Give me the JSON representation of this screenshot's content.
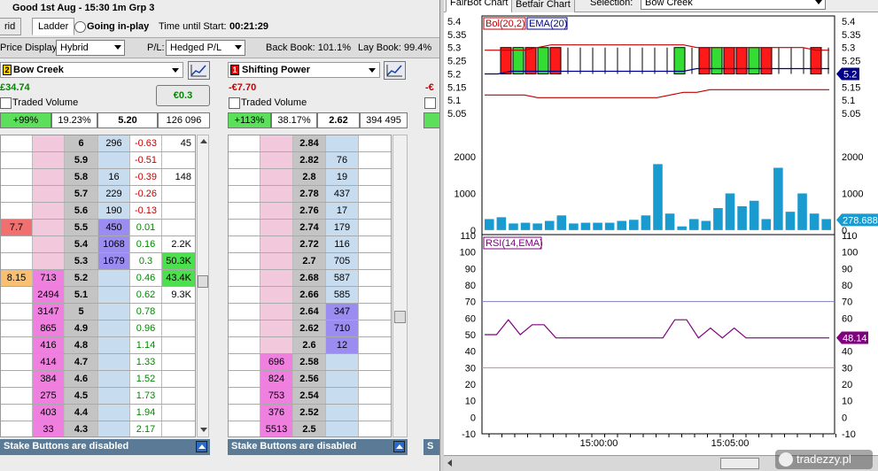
{
  "app": {
    "title": "Good 1st Aug - 15:30 1m Grp 3",
    "tab_hybrid_partial": "rid",
    "tab_ladder": "Ladder",
    "going_inplay": "Going in-play",
    "time_until_label": "Time until Start:",
    "time_until": "00:21:29"
  },
  "toolbar": {
    "price_display_label": "Price Display:",
    "price_display": "Hybrid",
    "pl_label": "P/L:",
    "pl_value": "Hedged P/L",
    "back_book": "Back Book: 101.1%",
    "lay_book": "Lay Book: 99.4%"
  },
  "runner1": {
    "num": "2",
    "name": "Bow Creek",
    "pnl": "£34.74",
    "hedge": "€0.3",
    "traded_volume": "Traded Volume",
    "stat_pct": "+99%",
    "stat_ratio": "19.23%",
    "stat_ltp": "5.20",
    "stat_vol": "126 096",
    "ladder": [
      [
        "",
        "",
        "6",
        "296",
        "-0.63",
        "45"
      ],
      [
        "",
        "",
        "5.9",
        "",
        "-0.51",
        ""
      ],
      [
        "",
        "",
        "5.8",
        "16",
        "-0.39",
        "148"
      ],
      [
        "",
        "",
        "5.7",
        "229",
        "-0.26",
        ""
      ],
      [
        "",
        "",
        "5.6",
        "190",
        "-0.13",
        ""
      ],
      [
        "7.7",
        "",
        "5.5",
        "450",
        "0.01",
        ""
      ],
      [
        "",
        "",
        "5.4",
        "1068",
        "0.16",
        "2.2K"
      ],
      [
        "",
        "",
        "5.3",
        "1679",
        "0.3",
        "50.3K"
      ],
      [
        "8.15",
        "713",
        "5.2",
        "",
        "0.46",
        "43.4K"
      ],
      [
        "",
        "2494",
        "5.1",
        "",
        "0.62",
        "9.3K"
      ],
      [
        "",
        "3147",
        "5",
        "",
        "0.78",
        ""
      ],
      [
        "",
        "865",
        "4.9",
        "",
        "0.96",
        ""
      ],
      [
        "",
        "416",
        "4.8",
        "",
        "1.14",
        ""
      ],
      [
        "",
        "414",
        "4.7",
        "",
        "1.33",
        ""
      ],
      [
        "",
        "384",
        "4.6",
        "",
        "1.52",
        ""
      ],
      [
        "",
        "275",
        "4.5",
        "",
        "1.73",
        ""
      ],
      [
        "",
        "403",
        "4.4",
        "",
        "1.94",
        ""
      ],
      [
        "",
        "33",
        "4.3",
        "",
        "2.17",
        ""
      ]
    ],
    "stake": "Stake Buttons are disabled"
  },
  "runner2": {
    "num": "1",
    "name": "Shifting Power",
    "pnl": "-€7.70",
    "traded_volume": "Traded Volume",
    "stat_pct": "+113%",
    "stat_ratio": "38.17%",
    "stat_ltp": "2.62",
    "stat_vol": "394 495",
    "ladder": [
      [
        "",
        "2.84",
        ""
      ],
      [
        "",
        "2.82",
        "76"
      ],
      [
        "",
        "2.8",
        "19"
      ],
      [
        "",
        "2.78",
        "437"
      ],
      [
        "",
        "2.76",
        "17"
      ],
      [
        "",
        "2.74",
        "179"
      ],
      [
        "",
        "2.72",
        "116"
      ],
      [
        "",
        "2.7",
        "705"
      ],
      [
        "",
        "2.68",
        "587"
      ],
      [
        "",
        "2.66",
        "585"
      ],
      [
        "",
        "2.64",
        "347"
      ],
      [
        "",
        "2.62",
        "710"
      ],
      [
        "",
        "2.6",
        "12"
      ],
      [
        "696",
        "2.58",
        ""
      ],
      [
        "824",
        "2.56",
        ""
      ],
      [
        "753",
        "2.54",
        ""
      ],
      [
        "376",
        "2.52",
        ""
      ],
      [
        "5513",
        "2.5",
        ""
      ]
    ],
    "stake": "Stake Buttons are disabled"
  },
  "runner3": {
    "pnl_partial": "-€",
    "stake_partial": "S"
  },
  "chart": {
    "tab_fairbot": "FairBot Chart",
    "tab_betfair": "Betfair Chart",
    "selection_label": "Selection:",
    "selection": "Bow Creek",
    "watermark": "tradezzy.pl",
    "legend_bol": "Bol(20,2)",
    "legend_ema": "EMA(20)",
    "legend_rsi": "RSI(14,EMA)",
    "colors": {
      "bull": "#33dd33",
      "bear": "#ff1a1a",
      "ema": "#00008b",
      "bol": "#c00000",
      "vol": "#1a9bd0",
      "rsi": "#800080"
    }
  },
  "chart_data": [
    {
      "type": "line",
      "title": "",
      "ylim": [
        5.0,
        5.42
      ],
      "y_ticks": [
        "5.4",
        "5.35",
        "5.3",
        "5.25",
        "5.2",
        "5.15",
        "5.1",
        "5.05"
      ],
      "last_label": "5.2",
      "series": [
        {
          "name": "Bol(20,2)",
          "values": [
            5.29,
            5.29,
            5.29,
            5.29,
            5.3,
            5.31,
            5.31,
            5.31,
            5.31,
            5.31,
            5.31,
            5.31,
            5.31,
            5.31,
            5.31,
            5.31,
            5.3,
            5.3,
            5.3,
            5.3,
            5.3,
            5.3,
            5.3,
            5.3,
            5.3,
            5.29,
            5.29
          ]
        },
        {
          "name": "EMA(20)",
          "values": [
            5.2,
            5.2,
            5.21,
            5.21,
            5.21,
            5.21,
            5.21,
            5.21,
            5.21,
            5.21,
            5.21,
            5.21,
            5.21,
            5.21,
            5.21,
            5.21,
            5.22,
            5.22,
            5.22,
            5.22,
            5.22,
            5.22,
            5.22,
            5.22,
            5.22,
            5.22,
            5.22
          ]
        },
        {
          "name": "lower band",
          "values": [
            5.12,
            5.12,
            5.12,
            5.12,
            5.11,
            5.11,
            5.11,
            5.11,
            5.11,
            5.11,
            5.11,
            5.11,
            5.11,
            5.11,
            5.12,
            5.13,
            5.13,
            5.14,
            5.14,
            5.14,
            5.14,
            5.14,
            5.14,
            5.14,
            5.14,
            5.14,
            5.14
          ]
        }
      ],
      "candles": [
        [
          "bear",
          5.3,
          5.2
        ],
        [
          "bull",
          5.2,
          5.3
        ],
        [
          "bear",
          5.3,
          5.2
        ],
        [
          "bull",
          5.2,
          5.3
        ],
        [
          "bear",
          5.3,
          5.2
        ],
        [
          "",
          5.2,
          5.2
        ],
        [
          "",
          5.2,
          5.2
        ],
        [
          "",
          5.2,
          5.2
        ],
        [
          "",
          5.2,
          5.2
        ],
        [
          "",
          5.2,
          5.2
        ],
        [
          "",
          5.2,
          5.2
        ],
        [
          "",
          5.2,
          5.2
        ],
        [
          "",
          5.2,
          5.2
        ],
        [
          "",
          5.2,
          5.2
        ],
        [
          "bull",
          5.2,
          5.3
        ],
        [
          "",
          5.2,
          5.2
        ],
        [
          "bear",
          5.3,
          5.2
        ],
        [
          "bull",
          5.2,
          5.3
        ],
        [
          "bear",
          5.3,
          5.2
        ],
        [
          "bear",
          5.3,
          5.2
        ],
        [
          "bull",
          5.2,
          5.3
        ],
        [
          "bear",
          5.3,
          5.2
        ],
        [
          "",
          5.2,
          5.2
        ],
        [
          "",
          5.2,
          5.2
        ],
        [
          "",
          5.2,
          5.2
        ],
        [
          "bear",
          5.3,
          5.2
        ],
        [
          "",
          5.2,
          5.2
        ]
      ]
    },
    {
      "type": "bar",
      "ylim": [
        -100,
        2800
      ],
      "y_ticks": [
        "2000",
        "1000",
        "0"
      ],
      "last_label": "278.688",
      "values": [
        300,
        350,
        180,
        200,
        180,
        250,
        400,
        180,
        200,
        200,
        200,
        250,
        280,
        400,
        1800,
        450,
        100,
        300,
        250,
        600,
        1000,
        650,
        800,
        300,
        1700,
        500,
        1000,
        450,
        300
      ]
    },
    {
      "type": "line",
      "ylim": [
        -10,
        110
      ],
      "y_ticks": [
        "110",
        "100",
        "90",
        "80",
        "70",
        "60",
        "50",
        "40",
        "30",
        "20",
        "10",
        "0",
        "-10"
      ],
      "last_label": "48.14",
      "lines": [
        70,
        30
      ],
      "series": [
        {
          "name": "RSI(14,EMA)",
          "values": [
            50,
            50,
            59,
            50,
            56,
            56,
            48,
            48,
            48,
            48,
            48,
            48,
            48,
            48,
            48,
            48,
            59,
            59,
            48,
            54,
            48,
            54,
            48,
            48,
            48,
            48,
            48,
            48,
            48,
            48
          ]
        }
      ],
      "x_ticks": [
        "15:00:00",
        "15:05:00"
      ]
    }
  ]
}
